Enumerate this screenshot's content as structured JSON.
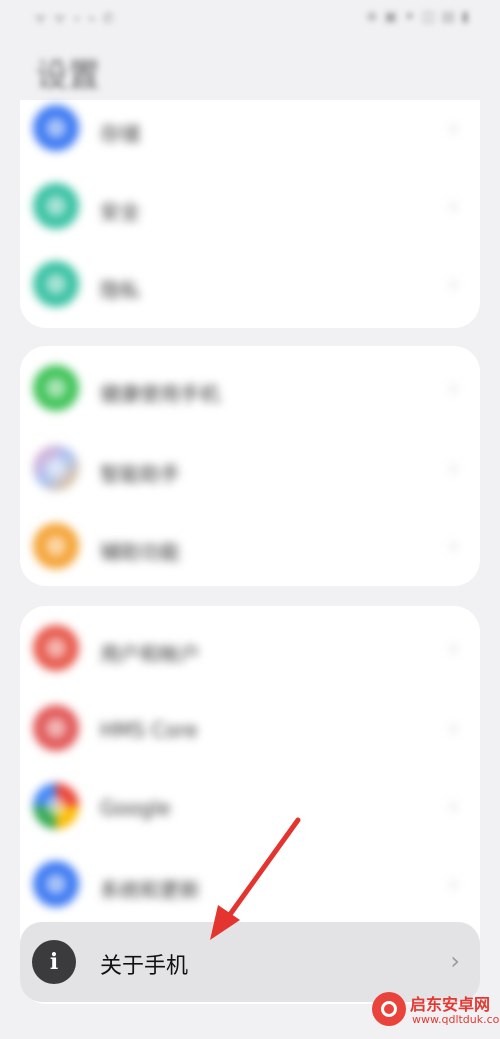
{
  "status_bar": {
    "left": "ᯤ ᯤ ⋆ ⌁ ✆",
    "right": "⊕ ▣ ✦ ◫ ▤ ▮"
  },
  "page_title": "设置",
  "groups": [
    {
      "items": [
        {
          "label": "存储",
          "icon": "storage-icon",
          "color": "#3f7bf2"
        },
        {
          "label": "安全",
          "icon": "security-icon",
          "color": "#3cc2a4"
        },
        {
          "label": "隐私",
          "icon": "privacy-icon",
          "color": "#3cc2a4"
        }
      ]
    },
    {
      "items": [
        {
          "label": "健康使用手机",
          "icon": "digital-balance-icon",
          "color": "#42c45a"
        },
        {
          "label": "智能助手",
          "icon": "smart-assistant-icon",
          "color": "#f08bb0"
        },
        {
          "label": "辅助功能",
          "icon": "accessibility-icon",
          "color": "#f5a53a"
        }
      ]
    },
    {
      "items": [
        {
          "label": "用户和帐户",
          "icon": "users-accounts-icon",
          "color": "#e85c4f"
        },
        {
          "label": "HMS Core",
          "icon": "hms-core-icon",
          "color": "#e25a5a"
        },
        {
          "label": "Google",
          "icon": "google-icon",
          "color": "#4285f4"
        },
        {
          "label": "系统和更新",
          "icon": "system-update-icon",
          "color": "#3f7bf2"
        }
      ],
      "highlighted": {
        "label": "关于手机",
        "icon": "info-icon"
      }
    }
  ],
  "chevron": "›",
  "info_glyph": "i",
  "watermark": {
    "title": "启东安卓网",
    "url": "www.qdltduk.com",
    "colors": {
      "brand": "#e23a33"
    }
  },
  "annotation": {
    "color": "#e3342f"
  }
}
